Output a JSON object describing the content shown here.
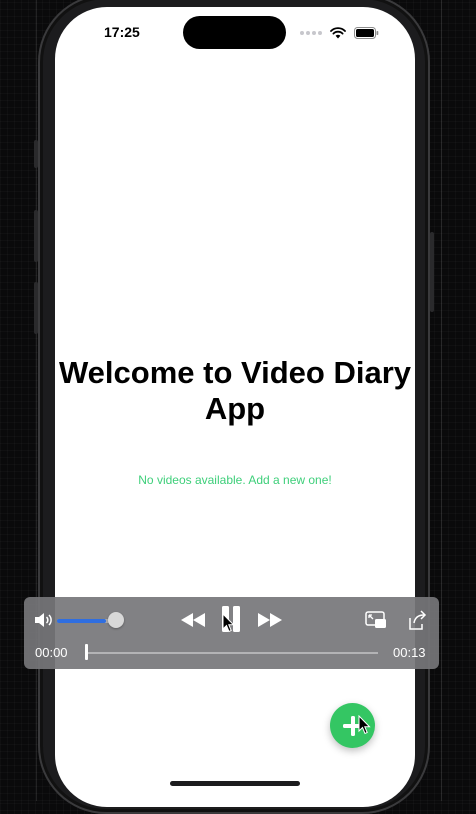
{
  "status_bar": {
    "time": "17:25"
  },
  "main": {
    "title": "Welcome to Video Diary App",
    "empty_message": "No videos available. Add a new one!"
  },
  "fab": {
    "label": "+",
    "icon": "plus-icon"
  },
  "player": {
    "current_time": "00:00",
    "duration": "00:13",
    "progress": 0,
    "volume": 0.85,
    "icons": [
      "speaker-icon",
      "rewind-icon",
      "pause-icon",
      "fast-forward-icon",
      "picture-in-picture-icon",
      "share-icon"
    ]
  },
  "colors": {
    "accent_green": "#34c663",
    "empty_text": "#3ecf7a",
    "volume_blue": "#2f6ee0",
    "player_bg": "#76767a"
  }
}
